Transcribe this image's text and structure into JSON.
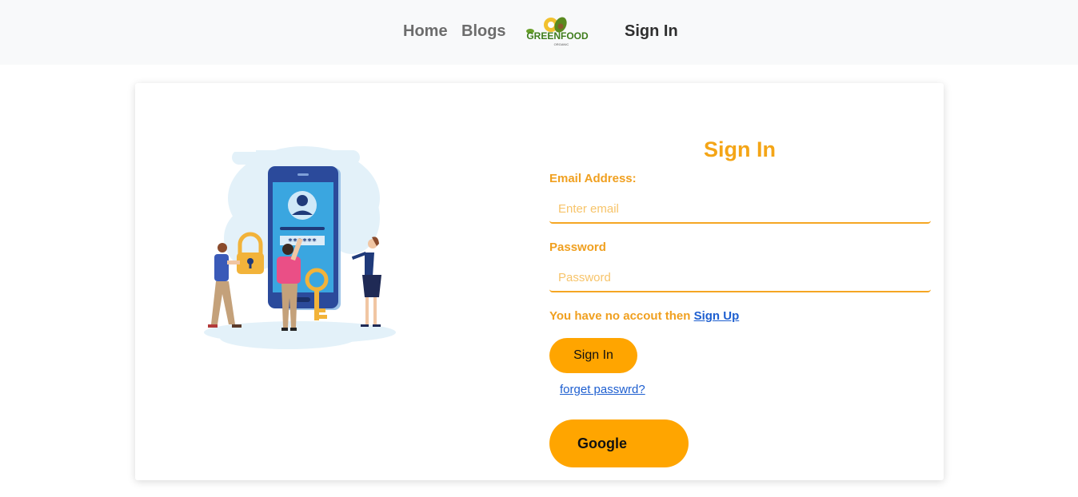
{
  "nav": {
    "home": "Home",
    "blogs": "Blogs",
    "logo_text": "GREENFOOD",
    "logo_subtext": "ORGANIC",
    "signin": "Sign In"
  },
  "form": {
    "title": "Sign In",
    "email_label": "Email Address:",
    "email_placeholder": "Enter email",
    "email_value": "",
    "password_label": "Password",
    "password_placeholder": "Password",
    "password_value": "",
    "no_account_text": "You have no accout then ",
    "signup_link": "Sign Up",
    "signin_button": "Sign In",
    "forgot_link": "forget passwrd?",
    "google_button": "Google"
  },
  "illustration": {
    "password_mask": "******"
  },
  "colors": {
    "accent": "#ffa500",
    "label": "#f0a020",
    "link": "#1e5fd0",
    "navbar_bg": "#f8f9fa"
  }
}
